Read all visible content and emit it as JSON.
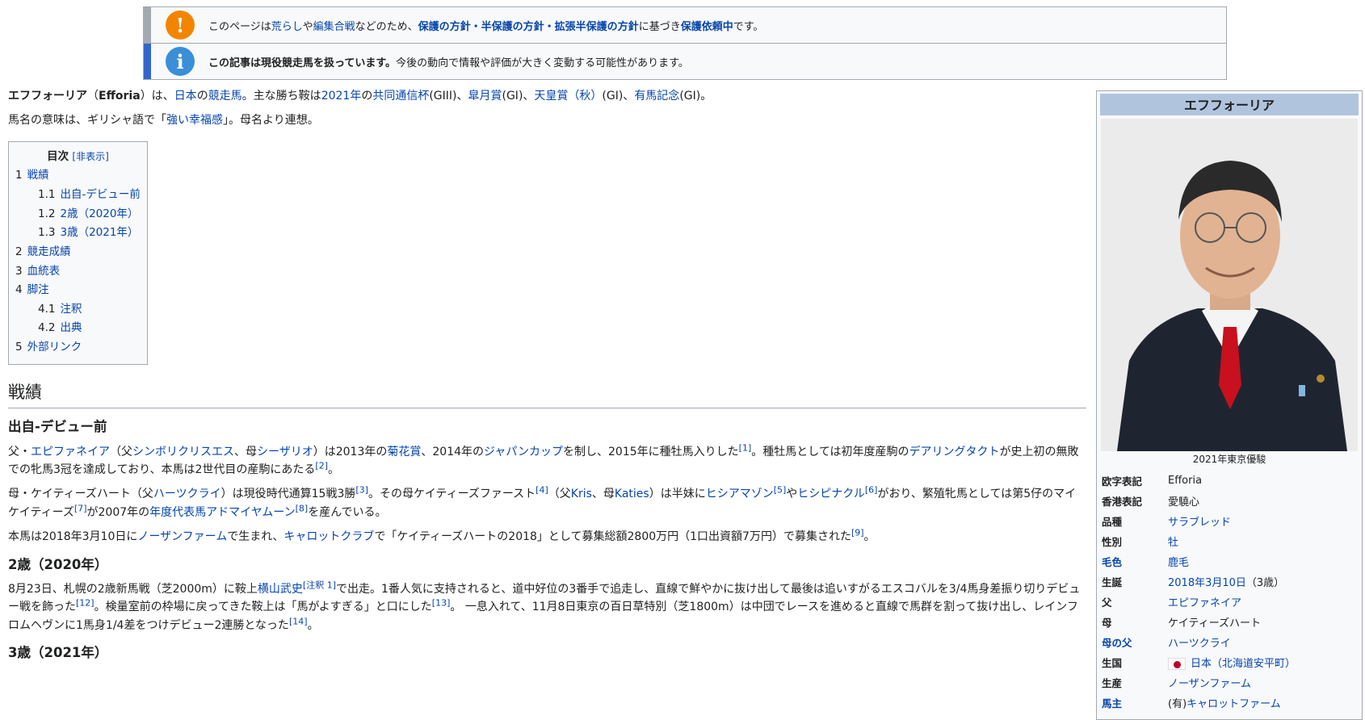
{
  "notices": {
    "protect": {
      "icon": "!",
      "parts": [
        "このページは",
        "荒らし",
        "や",
        "編集合戦",
        "などのため、",
        "保護の方針・半保護の方針・拡張半保護の方針",
        "に基づき",
        "保護依頼中",
        "です。"
      ]
    },
    "current": {
      "icon": "i",
      "bold": "この記事は現役競走馬を扱っています。",
      "rest": "今後の動向で情報や評価が大きく変動する可能性があります。"
    }
  },
  "intro": {
    "p1": [
      "エフフォーリア",
      "（",
      "Efforia",
      "）は、",
      "日本",
      "の",
      "競走馬",
      "。主な勝ち鞍は",
      "2021年",
      "の",
      "共同通信杯",
      "(GIII)、",
      "皐月賞",
      "(GI)、",
      "天皇賞（秋）",
      "(GI)、",
      "有馬記念",
      "(GI)。"
    ],
    "p2": [
      "馬名の意味は、ギリシャ語で「",
      "強い幸福感",
      "」。母名より連想。"
    ]
  },
  "toc": {
    "title": "目次",
    "toggle": "[非表示]",
    "items": [
      {
        "num": "1",
        "label": "戦績",
        "level": 1
      },
      {
        "num": "1.1",
        "label": "出自-デビュー前",
        "level": 2
      },
      {
        "num": "1.2",
        "label": "2歳（2020年）",
        "level": 2
      },
      {
        "num": "1.3",
        "label": "3歳（2021年）",
        "level": 2
      },
      {
        "num": "2",
        "label": "競走成績",
        "level": 1
      },
      {
        "num": "3",
        "label": "血統表",
        "level": 1
      },
      {
        "num": "4",
        "label": "脚注",
        "level": 1
      },
      {
        "num": "4.1",
        "label": "注釈",
        "level": 2
      },
      {
        "num": "4.2",
        "label": "出典",
        "level": 2
      },
      {
        "num": "5",
        "label": "外部リンク",
        "level": 1
      }
    ]
  },
  "sections": {
    "record": "戦績",
    "origin": "出自-デビュー前",
    "age2": "2歳（2020年）",
    "age3": "3歳（2021年）"
  },
  "paragraphs": {
    "origin1": [
      "父・",
      "エピファネイア",
      "（父",
      "シンボリクリスエス",
      "、母",
      "シーザリオ",
      "）は2013年の",
      "菊花賞",
      "、2014年の",
      "ジャパンカップ",
      "を制し、2015年に種牡馬入りした",
      "[1]",
      "。種牡馬としては初年度産駒の",
      "デアリングタクト",
      "が史上初の無敗での牝馬3冠を達成しており、本馬は2世代目の産駒にあたる",
      "[2]",
      "。"
    ],
    "origin2": [
      "母・ケイティーズハート（父",
      "ハーツクライ",
      "）は現役時代通算15戦3勝",
      "[3]",
      "。その母ケイティーズファースト",
      "[4]",
      "（父",
      "Kris",
      "、母",
      "Katies",
      "）は半妹に",
      "ヒシアマゾン",
      "[5]",
      "や",
      "ヒシピナクル",
      "[6]",
      "がおり、繁殖牝馬としては第5仔のマイケイティーズ",
      "[7]",
      "が2007年の",
      "年度代表馬",
      "アドマイヤムーン",
      "[8]",
      "を産んでいる。"
    ],
    "origin3": [
      "本馬は2018年3月10日に",
      "ノーザンファーム",
      "で生まれ、",
      "キャロットクラブ",
      "で「ケイティーズハートの2018」として募集総額2800万円（1口出資額7万円）で募集された",
      "[9]",
      "。"
    ],
    "age2": [
      "8月23日、札幌の2歳新馬戦（芝2000m）に鞍上",
      "横山武史",
      "[注釈 1]",
      "で出走。1番人気に支持されると、道中好位の3番手で追走し、直線で鮮やかに抜け出して最後は追いすがるエスコバルを3/4馬身差振り切りデビュー戦を飾った",
      "[12]",
      "。検量室前の枠場に戻ってきた鞍上は「馬がよすぎる」と口にした",
      "[13]",
      "。 一息入れて、11月8日東京の百日草特別（芝1800m）は中団でレースを進めると直線で馬群を割って抜け出し、レインフロムヘヴンに1馬身1/4差をつけデビュー2連勝となった",
      "[14]",
      "。"
    ]
  },
  "infobox": {
    "title": "エフフォーリア",
    "caption": "2021年東京優駿",
    "rows": [
      {
        "label": "欧字表記",
        "value": "Efforia",
        "label_link": false,
        "value_link": false
      },
      {
        "label": "香港表記",
        "value": "愛驍心",
        "label_link": false,
        "value_link": false
      },
      {
        "label": "品種",
        "value": "サラブレッド",
        "label_link": false,
        "value_link": true
      },
      {
        "label": "性別",
        "value": "牡",
        "label_link": false,
        "value_link": true
      },
      {
        "label": "毛色",
        "value": "鹿毛",
        "label_link": true,
        "value_link": true
      },
      {
        "label": "生誕",
        "value": "2018年3月10日",
        "value_suffix": "（3歳）",
        "label_link": false,
        "value_link": true
      },
      {
        "label": "父",
        "value": "エピファネイア",
        "label_link": false,
        "value_link": true
      },
      {
        "label": "母",
        "value": "ケイティーズハート",
        "label_link": false,
        "value_link": false
      },
      {
        "label": "母の父",
        "value": "ハーツクライ",
        "label_link": true,
        "value_link": true
      },
      {
        "label": "生国",
        "value": "日本（北海道安平町）",
        "label_link": false,
        "value_link": true,
        "flag": true
      },
      {
        "label": "生産",
        "value": "ノーザンファーム",
        "label_link": false,
        "value_link": true
      },
      {
        "label": "馬主",
        "value": "キャロットファーム",
        "value_prefix": "(有)",
        "label_link": true,
        "value_link": true
      }
    ]
  },
  "colors": {
    "link": "#0645ad",
    "protect_bar": "#a2a9b1",
    "protect_icon": "#f28500",
    "info_bar": "#36c",
    "info_icon": "#3a8fd8",
    "infobox_title": "#b0c4de"
  }
}
